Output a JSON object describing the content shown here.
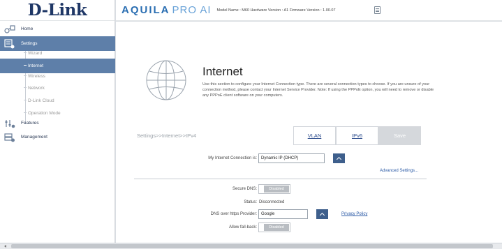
{
  "logo": "D-Link",
  "header": {
    "brand_bold": "AQUILA",
    "brand_light": "PRO AI",
    "info": "Model Name : M60 Hardware Version : A1 Firmware Version : 1.00.07"
  },
  "sidebar": {
    "home": "Home",
    "settings": "Settings",
    "subitems": [
      "Wizard",
      "Internet",
      "Wireless",
      "Network",
      "D-Link Cloud",
      "Operation Mode"
    ],
    "features": "Features",
    "management": "Management"
  },
  "page": {
    "title": "Internet",
    "description": "Use this section to configure your Internet Connection type. There are several connection types to choose. If you are unsure of your connection method, please contact your Internet Service Provider. Note: If using the PPPoE option, you will need to remove or disable any PPPoE client software on your computers.",
    "breadcrumb": "Settings>>Internet>>IPv4",
    "tabs": {
      "vlan": "VLAN",
      "ipv6": "IPv6",
      "save": "Save"
    },
    "connection_label": "My Internet Connection is:",
    "connection_value": "Dynamic IP (DHCP)",
    "advanced_link": "Advanced Settings...",
    "secure_dns_label": "Secure DNS:",
    "secure_dns_value": "Disabled",
    "status_label": "Status:",
    "status_value": "Disconnected",
    "doh_label": "DNS over https Provider:",
    "doh_value": "Google",
    "privacy_link": "Privacy Policy",
    "fallback_label": "Allow fall-back:",
    "fallback_value": "Disabled"
  },
  "colors": {
    "accent": "#5e7fa9",
    "dropdown_button": "#3e5f8c",
    "link": "#2b5aa6",
    "logo": "#1f3766"
  }
}
